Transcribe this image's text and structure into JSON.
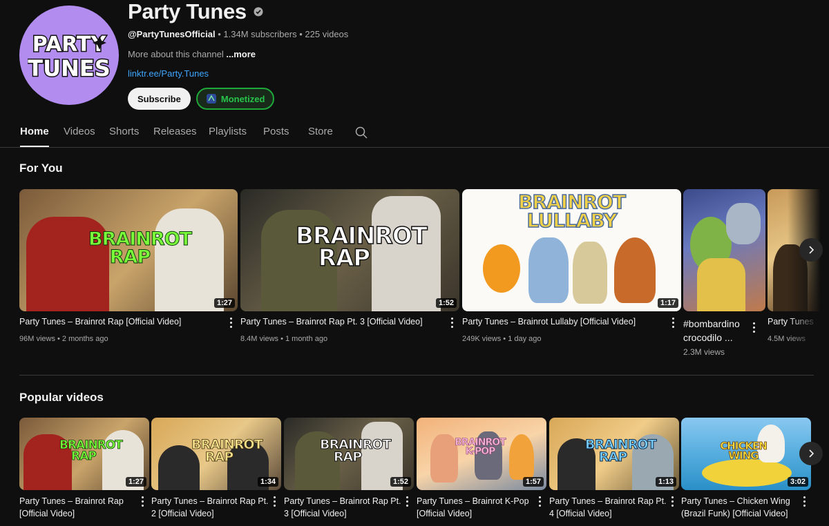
{
  "channel": {
    "name": "Party Tunes",
    "handle": "@PartyTunesOfficial",
    "subscribers": "1.34M subscribers",
    "videos": "225 videos",
    "description": "More about this channel ",
    "more": "...more",
    "link": "linktr.ee/Party.Tunes",
    "subscribe_label": "Subscribe",
    "monetized_label": "Monetized",
    "logo_line1": "PARTY",
    "logo_line2": "TUNES"
  },
  "tabs": [
    "Home",
    "Videos",
    "Shorts",
    "Releases",
    "Playlists",
    "Posts",
    "Store"
  ],
  "for_you": {
    "title": "For You",
    "items": [
      {
        "title": "Party Tunes – Brainrot Rap [Official Video]",
        "meta": "96M views • 2 months ago",
        "duration": "1:27",
        "thumb_text": "BRAINROT RAP"
      },
      {
        "title": "Party Tunes – Brainrot Rap Pt. 3 [Official Video]",
        "meta": "8.4M views • 1 month ago",
        "duration": "1:52",
        "thumb_text": "BRAINROT RAP"
      },
      {
        "title": "Party Tunes – Brainrot Lullaby [Official Video]",
        "meta": "249K views • 1 day ago",
        "duration": "1:17",
        "thumb_text": "BRAINROT LULLABY"
      },
      {
        "title": "#bombardino crocodilo ...",
        "meta": "2.3M views"
      },
      {
        "title": "Party Tunes",
        "meta": "4.5M views"
      }
    ]
  },
  "popular": {
    "title": "Popular videos",
    "items": [
      {
        "title": "Party Tunes – Brainrot Rap [Official Video]",
        "duration": "1:27",
        "thumb_text": "BRAINROT RAP"
      },
      {
        "title": "Party Tunes – Brainrot Rap Pt. 2 [Official Video]",
        "duration": "1:34",
        "thumb_text": "BRAINROT RAP"
      },
      {
        "title": "Party Tunes – Brainrot Rap Pt. 3 [Official Video]",
        "duration": "1:52",
        "thumb_text": "BRAINROT RAP"
      },
      {
        "title": "Party Tunes – Brainrot K-Pop [Official Video]",
        "duration": "1:57",
        "thumb_text": "BRAINROT K-POP"
      },
      {
        "title": "Party Tunes – Brainrot Rap Pt. 4 [Official Video]",
        "duration": "1:13",
        "thumb_text": "BRAINROT RAP"
      },
      {
        "title": "Party Tunes – Chicken Wing (Brazil Funk) [Official Video]",
        "duration": "3:02",
        "thumb_text": "CHICKEN WING"
      }
    ]
  },
  "colors": {
    "bg": "#0f0f0f",
    "accent_link": "#3ea6ff",
    "monetized_green": "#27c44a",
    "avatar_purple": "#b38cf0"
  }
}
